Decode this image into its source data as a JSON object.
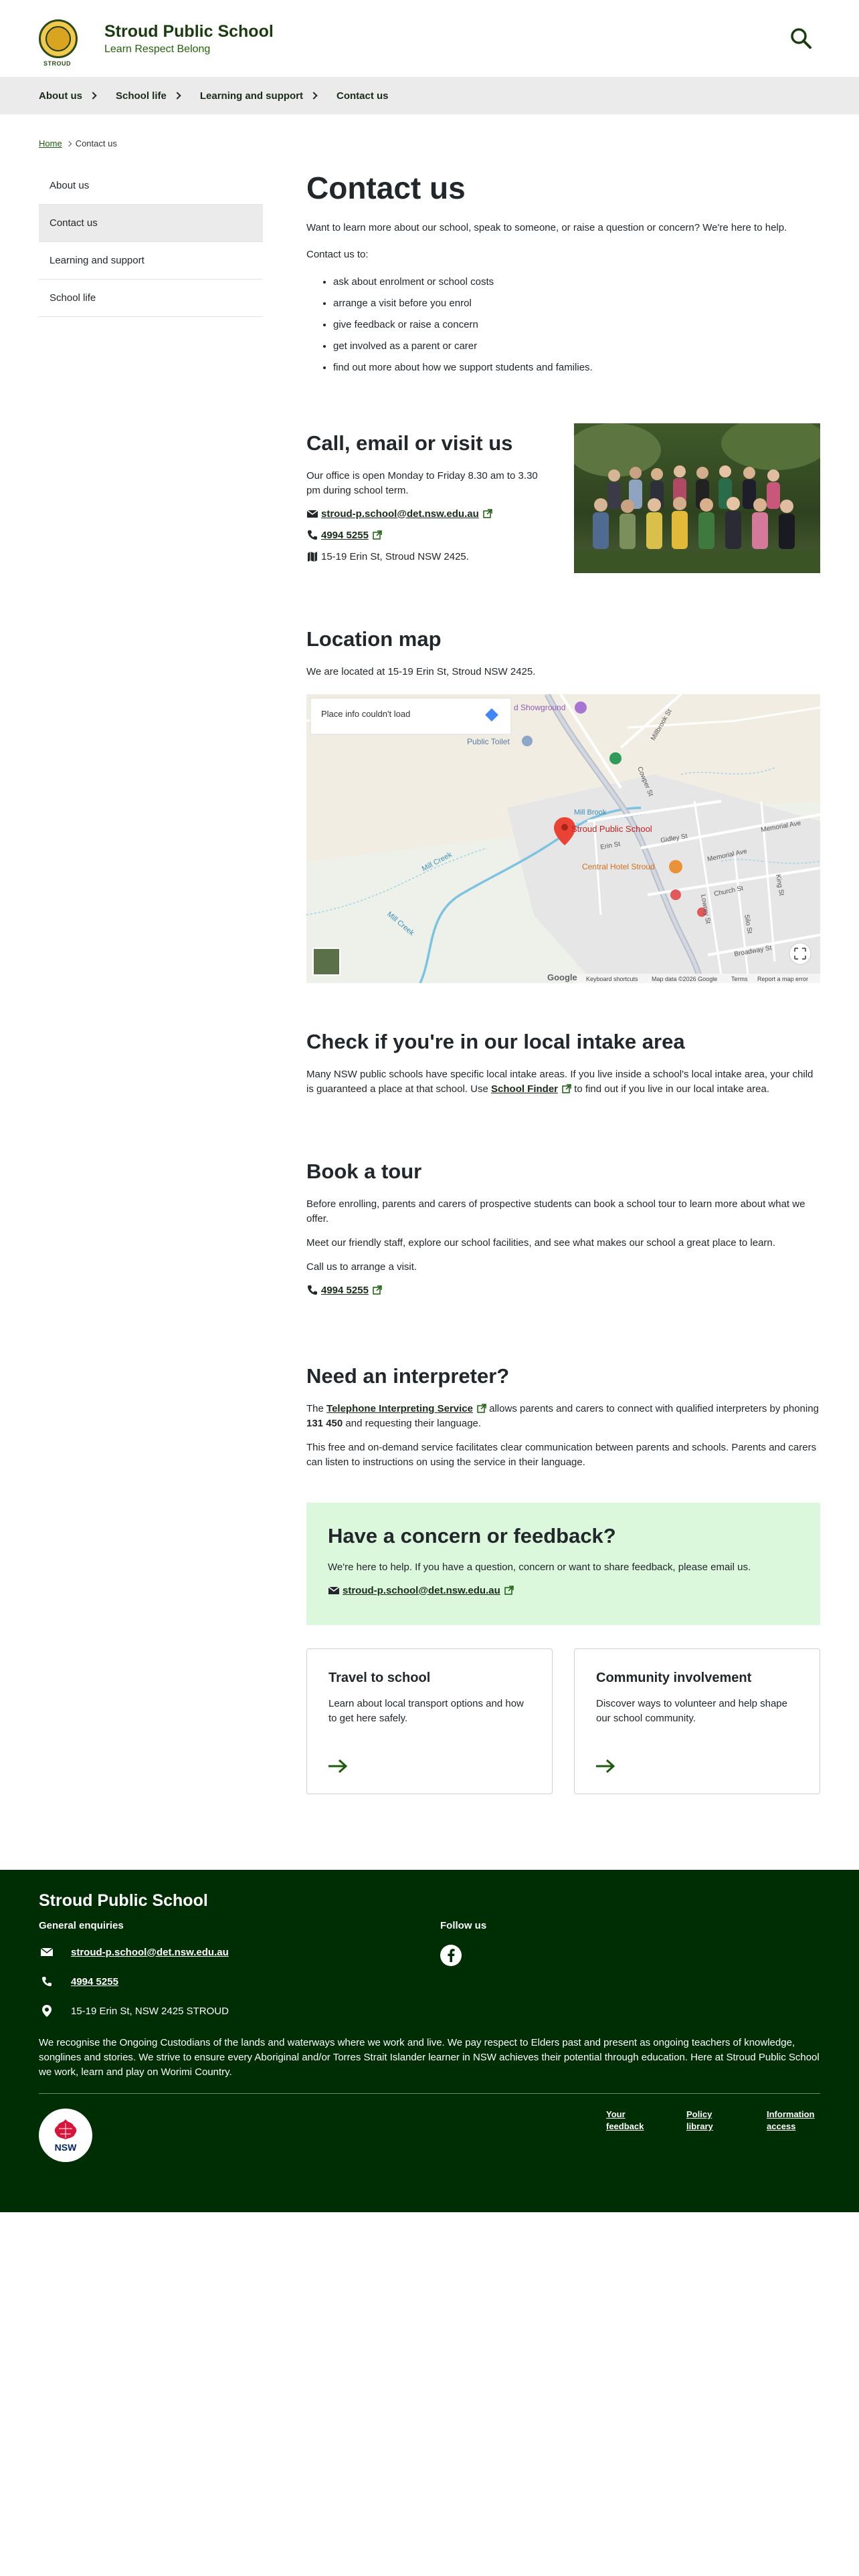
{
  "header": {
    "logo_text": "STROUD",
    "school_name": "Stroud Public School",
    "tagline": "Learn Respect Belong"
  },
  "nav": {
    "items": [
      {
        "label": "About us"
      },
      {
        "label": "School life"
      },
      {
        "label": "Learning and support"
      },
      {
        "label": "Contact us"
      }
    ]
  },
  "breadcrumb": {
    "home": "Home",
    "current": "Contact us"
  },
  "sidebar": {
    "items": [
      {
        "label": "About us"
      },
      {
        "label": "Contact us"
      },
      {
        "label": "Learning and support"
      },
      {
        "label": "School life"
      }
    ]
  },
  "intro": {
    "title": "Contact us",
    "lead": "Want to learn more about our school, speak to someone, or raise a question or concern? We're here to help.",
    "contact_to": "Contact us to:",
    "bullets": [
      "ask about enrolment or school costs",
      "arrange a visit before you enrol",
      "give feedback or raise a concern",
      "get involved as a parent or carer",
      "find out more about how we support students and families."
    ]
  },
  "call": {
    "title": "Call, email or visit us",
    "hours": "Our office is open Monday to Friday 8.30 am to 3.30 pm during school term.",
    "email": "stroud-p.school@det.nsw.edu.au",
    "phone": "4994 5255",
    "address": "15-19 Erin St, Stroud NSW 2425."
  },
  "map": {
    "title": "Location map",
    "desc": "We are located at 15-19 Erin St, Stroud NSW 2425.",
    "info_box": "Place info couldn't load",
    "pin_label": "Stroud Public School",
    "labels": {
      "showground": "d Showground",
      "toilet": "Public Toilet",
      "hotel": "Central Hotel Stroud",
      "mill_brook": "Mill Brook",
      "mill_creek_1": "Mill Creek",
      "mill_creek_2": "Mill Creek",
      "erin": "Erin St",
      "gidley": "Gidley St",
      "memorial": "Memorial Ave",
      "memorial2": "Memorial Ave",
      "church": "Church St",
      "broadway": "Broadway St",
      "cowper": "Cowper St",
      "king": "King St",
      "silo": "Silo St",
      "millbrook_st": "Millbrook St",
      "lowrey": "Lowrey St"
    },
    "footer": {
      "google": "Google",
      "shortcuts": "Keyboard shortcuts",
      "data": "Map data ©2026 Google",
      "terms": "Terms",
      "report": "Report a map error"
    }
  },
  "intake": {
    "title": "Check if you're in our local intake area",
    "text_before": "Many NSW public schools have specific local intake areas. If you live inside a school's local intake area, your child is guaranteed a place at that school. Use ",
    "link": "School Finder",
    "text_after": " to find out if you live in our local intake area."
  },
  "tour": {
    "title": "Book a tour",
    "p1": "Before enrolling, parents and carers of prospective students can book a school tour to learn more about what we offer.",
    "p2": "Meet our friendly staff, explore our school facilities, and see what makes our school a great place to learn.",
    "p3": "Call us to arrange a visit.",
    "phone": "4994 5255"
  },
  "interpreter": {
    "title": "Need an interpreter?",
    "text_the": "The ",
    "link": "Telephone Interpreting Service",
    "text_mid": " allows parents and carers to connect with qualified interpreters by phoning ",
    "number": "131 450",
    "text_end": " and requesting their language.",
    "p2": "This free and on-demand service facilitates clear communication between parents and schools. Parents and carers can listen to instructions on using the service in their language."
  },
  "concern": {
    "title": "Have a concern or feedback?",
    "text": "We're here to help. If you have a question, concern or want to share feedback, please email us.",
    "email": "stroud-p.school@det.nsw.edu.au"
  },
  "cards": [
    {
      "title": "Travel to school",
      "text": "Learn about local transport options and how to get here safely."
    },
    {
      "title": "Community involvement",
      "text": "Discover ways to volunteer and help shape our school community."
    }
  ],
  "footer": {
    "title": "Stroud Public School",
    "general": "General enquiries",
    "email": "stroud-p.school@det.nsw.edu.au",
    "phone": "4994 5255",
    "address": "15-19 Erin St, NSW 2425 STROUD",
    "follow": "Follow us",
    "ack": "We recognise the Ongoing Custodians of the lands and waterways where we work and live. We pay respect to Elders past and present as ongoing teachers of knowledge, songlines and stories. We strive to ensure every Aboriginal and/or Torres Strait Islander learner in NSW achieves their potential through education. Here at Stroud Public School we work, learn and play on Worimi Country.",
    "nsw_logo": "NSW",
    "links": [
      "Your feedback",
      "Policy library",
      "Information access"
    ]
  },
  "colors": {
    "brand_green": "#002e04",
    "link_green": "#1a5c0b",
    "concern_bg": "#dbf7dc",
    "nav_bg": "#ebebeb"
  }
}
